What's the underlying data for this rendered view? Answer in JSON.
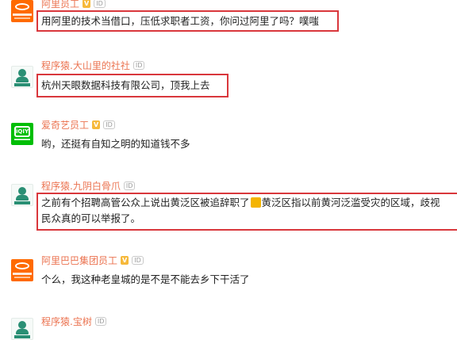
{
  "comments": [
    {
      "username": "阿里员工",
      "has_v_badge": true,
      "v_badge": "V",
      "id_badge": "ID",
      "avatar": "alibaba-logo-icon",
      "text": "用阿里的技术当借口，压低求职者工资，你问过阿里了吗？噗嗤",
      "highlighted": true
    },
    {
      "username": "程序猿.大山里的社社",
      "has_v_badge": false,
      "id_badge": "ID",
      "avatar": "developer-avatar-icon",
      "text": "杭州天眼数据科技有限公司，顶我上去",
      "highlighted": true
    },
    {
      "username": "爱奇艺员工",
      "has_v_badge": true,
      "v_badge": "V",
      "id_badge": "ID",
      "avatar": "iqiyi-logo-icon",
      "text": "哟，还挺有自知之明的知道钱不多",
      "highlighted": false
    },
    {
      "username": "程序猿.九阴白骨爪",
      "has_v_badge": false,
      "id_badge": "ID",
      "avatar": "developer-avatar-icon",
      "text_line1_a": "之前有个招聘高管公众上说出黄泛区被追辞职了",
      "text_line1_b": "黄泛区指以前黄河泛滥受灾的区域，歧视",
      "text_line2": "民众真的可以举报了。",
      "emoji": "pleading-emoji-icon",
      "highlighted": true
    },
    {
      "username": "阿里巴巴集团员工",
      "has_v_badge": true,
      "v_badge": "V",
      "id_badge": "ID",
      "avatar": "alibaba-logo-icon",
      "text": "个么，我这种老皇城的是不是不能去乡下干活了",
      "highlighted": false
    },
    {
      "username": "程序猿.宝树",
      "has_v_badge": false,
      "id_badge": "ID",
      "avatar": "developer-avatar-icon",
      "text": "",
      "highlighted": false
    }
  ],
  "colors": {
    "username": "#eb7350",
    "highlight_border": "#d9373c",
    "v_badge": "#f6b93b"
  }
}
